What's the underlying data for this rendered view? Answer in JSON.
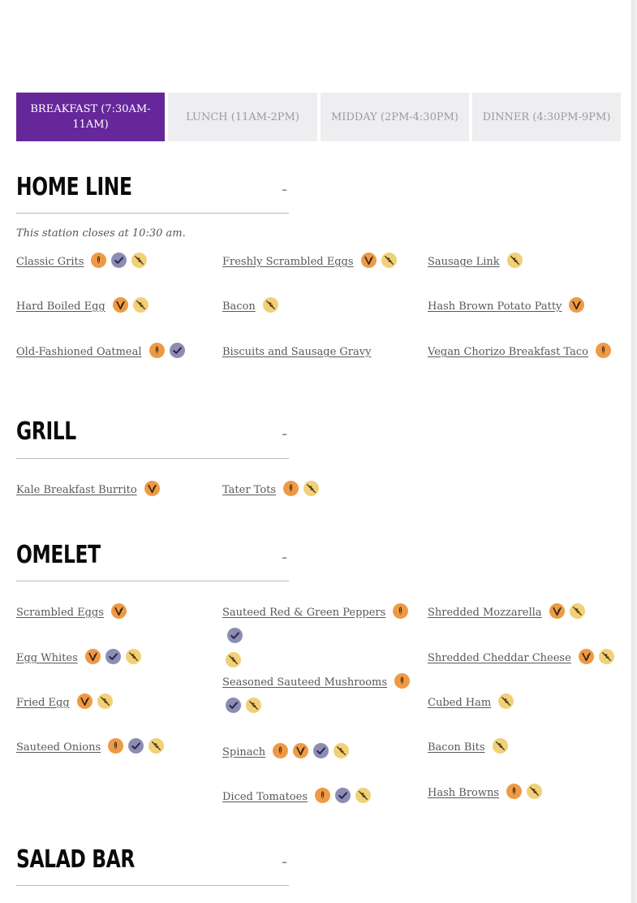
{
  "tabs": [
    {
      "label": "BREAKFAST (7:30AM-11AM)"
    },
    {
      "label": "LUNCH (11AM-2PM)"
    },
    {
      "label": "MIDDAY (2PM-4:30PM)"
    },
    {
      "label": "DINNER (4:30PM-9PM)"
    }
  ],
  "active_tab": "BREAKFAST (7:30AM-11AM)",
  "colors": {
    "accent": "#66279a",
    "vegan_icon": "#ee9a45",
    "vegetarian_icon": "#ee9a45",
    "gf_icon": "#8c8cb4",
    "allergen_icon": "#f1d078"
  },
  "collapse_symbol": "-",
  "sections": [
    {
      "title": "HOME LINE",
      "note": "This station closes at 10:30 am.",
      "items": [
        {
          "name": "Classic Grits",
          "icons": [
            "vegan-icon",
            "gluten-free-icon",
            "no-allergen-icon"
          ]
        },
        {
          "name": "Freshly Scrambled Eggs",
          "icons": [
            "vegetarian-icon",
            "no-allergen-icon"
          ]
        },
        {
          "name": "Sausage Link",
          "icons": [
            "no-allergen-icon"
          ]
        },
        {
          "name": "Hard Boiled Egg",
          "icons": [
            "vegetarian-icon",
            "no-allergen-icon"
          ]
        },
        {
          "name": "Bacon",
          "icons": [
            "no-allergen-icon"
          ]
        },
        {
          "name": "Hash Brown Potato Patty",
          "icons": [
            "vegetarian-icon"
          ]
        },
        {
          "name": "Old-Fashioned Oatmeal",
          "icons": [
            "vegan-icon",
            "gluten-free-icon"
          ]
        },
        {
          "name": "Biscuits and Sausage Gravy",
          "icons": []
        },
        {
          "name": "Vegan Chorizo Breakfast Taco",
          "icons": [
            "vegan-icon"
          ]
        }
      ]
    },
    {
      "title": "GRILL",
      "items": [
        {
          "name": "Kale Breakfast Burrito",
          "icons": [
            "vegetarian-icon"
          ]
        },
        {
          "name": "Tater Tots",
          "icons": [
            "vegan-icon",
            "no-allergen-icon"
          ]
        }
      ]
    },
    {
      "title": "OMELET",
      "items": [
        {
          "name": "Scrambled Eggs",
          "icons": [
            "vegetarian-icon"
          ]
        },
        {
          "name": "Sauteed Red & Green Peppers",
          "icons": [
            "vegan-icon",
            "gluten-free-icon",
            "no-allergen-icon"
          ]
        },
        {
          "name": "Shredded Mozzarella",
          "icons": [
            "vegetarian-icon",
            "no-allergen-icon"
          ]
        },
        {
          "name": "Egg Whites",
          "icons": [
            "vegetarian-icon",
            "gluten-free-icon",
            "no-allergen-icon"
          ]
        },
        {
          "name": "Seasoned Sauteed Mushrooms",
          "icons": [
            "vegan-icon",
            "gluten-free-icon",
            "no-allergen-icon"
          ]
        },
        {
          "name": "Shredded Cheddar Cheese",
          "icons": [
            "vegetarian-icon",
            "no-allergen-icon"
          ]
        },
        {
          "name": "Fried Egg",
          "icons": [
            "vegetarian-icon",
            "no-allergen-icon"
          ]
        },
        {
          "name": "Cubed Ham",
          "icons": [
            "no-allergen-icon"
          ]
        },
        {
          "name": "Sauteed Onions",
          "icons": [
            "vegan-icon",
            "gluten-free-icon",
            "no-allergen-icon"
          ]
        },
        {
          "name": "Spinach",
          "icons": [
            "vegan-icon",
            "vegetarian-icon",
            "gluten-free-icon",
            "no-allergen-icon"
          ]
        },
        {
          "name": "Bacon Bits",
          "icons": [
            "no-allergen-icon"
          ]
        },
        {
          "name": "Diced Tomatoes",
          "icons": [
            "vegan-icon",
            "gluten-free-icon",
            "no-allergen-icon"
          ]
        },
        {
          "name": "Hash Browns",
          "icons": [
            "vegan-icon",
            "no-allergen-icon"
          ]
        }
      ]
    },
    {
      "title": "SALAD BAR",
      "items": []
    }
  ]
}
